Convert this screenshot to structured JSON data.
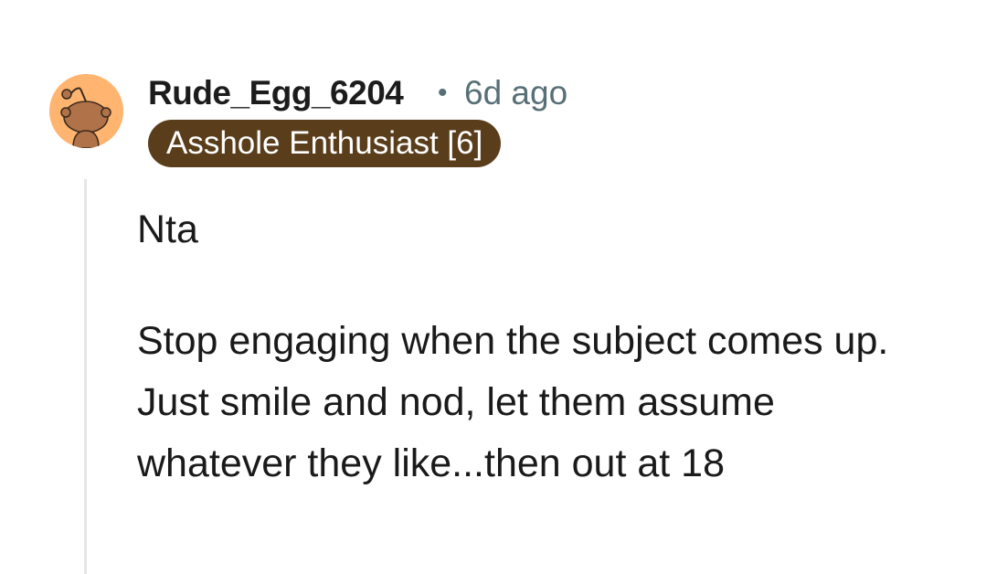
{
  "comment": {
    "author": "Rude_Egg_6204",
    "separator": "•",
    "timestamp": "6d ago",
    "flair": "Asshole Enthusiast [6]",
    "avatar_icon": "snoo-avatar-icon",
    "body": {
      "line1": "Nta",
      "line2": "Stop engaging when the subject comes up.   Just smile and nod, let them assume whatever they like...then out at 18"
    }
  },
  "colors": {
    "avatar_bg": "#ffb470",
    "flair_bg": "#5a3e1b",
    "meta_text": "#576f76",
    "thread_line": "#e4e6e8"
  }
}
